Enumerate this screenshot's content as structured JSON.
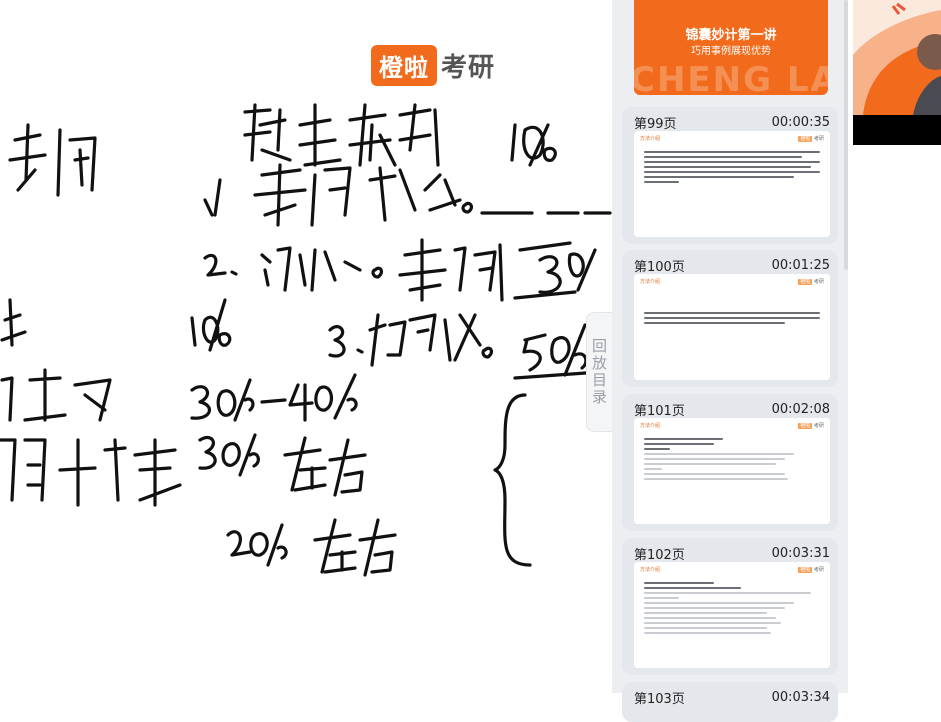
{
  "logo": {
    "box": "橙啦",
    "text": "考研"
  },
  "catalog_tab": {
    "label": "回放目录"
  },
  "first_slide": {
    "title": "锦囊妙计第一讲",
    "subtitle": "巧用事例展现优势",
    "watermark": "CHENG LA"
  },
  "pages": [
    {
      "label": "第99页",
      "time": "00:00:35"
    },
    {
      "label": "第100页",
      "time": "00:01:25"
    },
    {
      "label": "第101页",
      "time": "00:02:08"
    },
    {
      "label": "第102页",
      "time": "00:03:31"
    },
    {
      "label": "第103页",
      "time": "00:03:34"
    }
  ],
  "thumb": {
    "tag": "方法介绍",
    "tag2": "橙啦",
    "brand": "考研"
  },
  "colors": {
    "brand_orange": "#f26b1d",
    "panel_bg": "#eceef1",
    "card_bg": "#e4e7eb"
  }
}
